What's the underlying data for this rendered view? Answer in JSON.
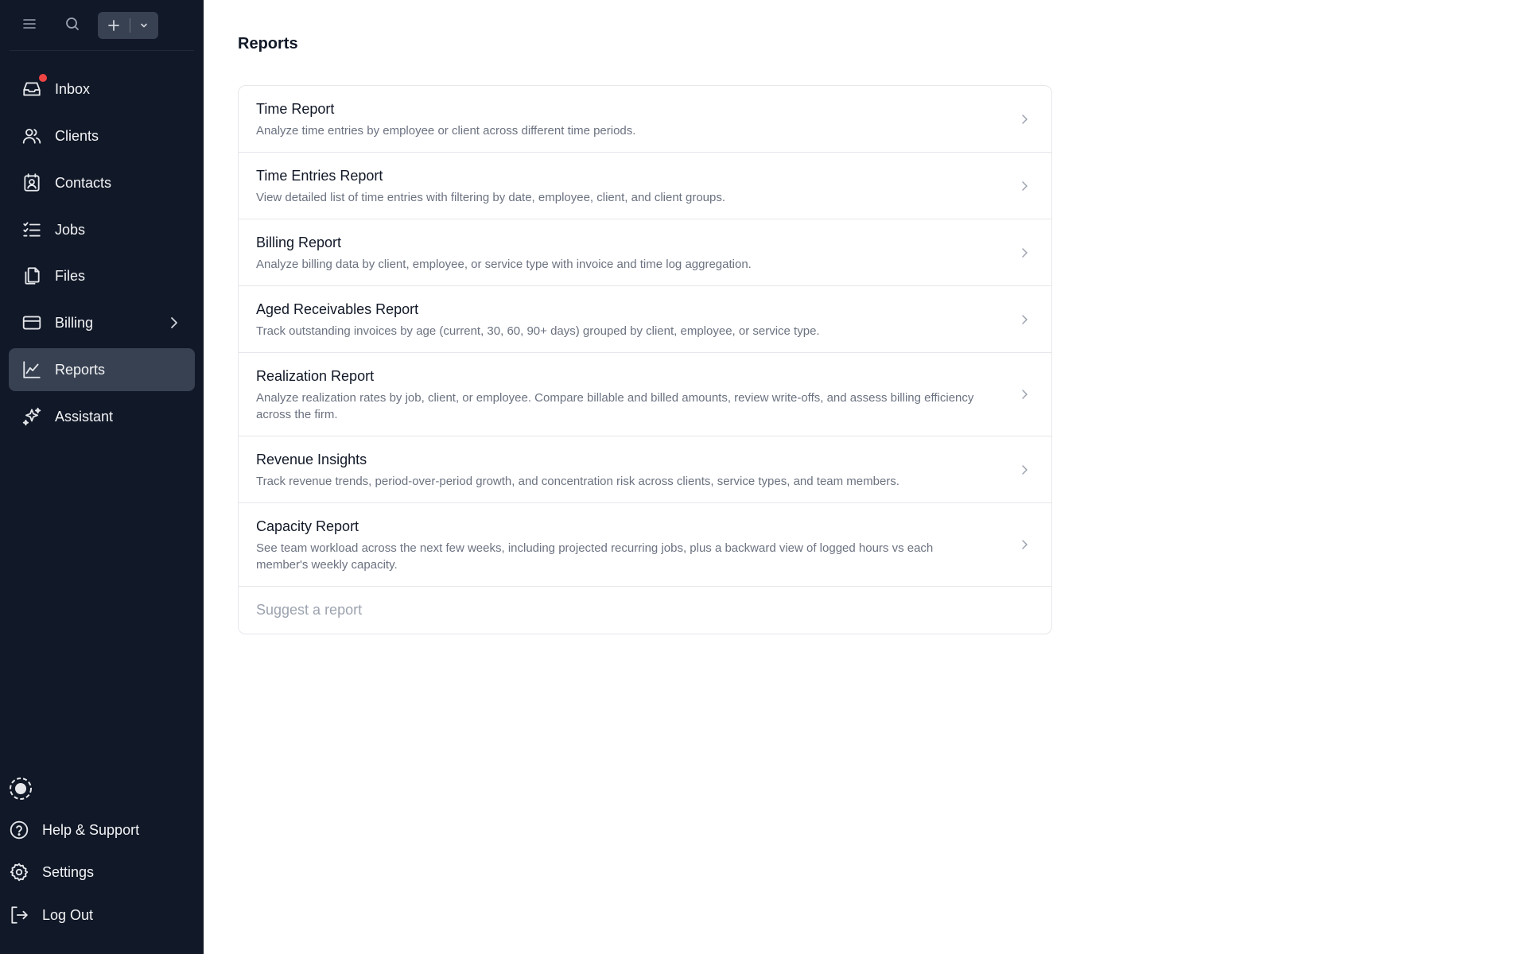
{
  "sidebar": {
    "nav": [
      {
        "label": "Inbox",
        "icon": "inbox-icon",
        "badge": true
      },
      {
        "label": "Clients",
        "icon": "users-icon"
      },
      {
        "label": "Contacts",
        "icon": "contact-card-icon"
      },
      {
        "label": "Jobs",
        "icon": "checklist-icon"
      },
      {
        "label": "Files",
        "icon": "files-icon"
      },
      {
        "label": "Billing",
        "icon": "credit-card-icon",
        "has_submenu": true
      },
      {
        "label": "Reports",
        "icon": "chart-line-icon",
        "active": true
      },
      {
        "label": "Assistant",
        "icon": "sparkles-icon"
      }
    ],
    "bottom": [
      {
        "label": "Help & Support",
        "icon": "help-circle-icon"
      },
      {
        "label": "Settings",
        "icon": "gear-icon"
      },
      {
        "label": "Log Out",
        "icon": "logout-icon"
      }
    ]
  },
  "main": {
    "title": "Reports",
    "reports": [
      {
        "title": "Time Report",
        "description": "Analyze time entries by employee or client across different time periods."
      },
      {
        "title": "Time Entries Report",
        "description": "View detailed list of time entries with filtering by date, employee, client, and client groups."
      },
      {
        "title": "Billing Report",
        "description": "Analyze billing data by client, employee, or service type with invoice and time log aggregation."
      },
      {
        "title": "Aged Receivables Report",
        "description": "Track outstanding invoices by age (current, 30, 60, 90+ days) grouped by client, employee, or service type."
      },
      {
        "title": "Realization Report",
        "description": "Analyze realization rates by job, client, or employee. Compare billable and billed amounts, review write-offs, and assess billing efficiency across the firm."
      },
      {
        "title": "Revenue Insights",
        "description": "Track revenue trends, period-over-period growth, and concentration risk across clients, service types, and team members."
      },
      {
        "title": "Capacity Report",
        "description": "See team workload across the next few weeks, including projected recurring jobs, plus a backward view of logged hours vs each member's weekly capacity."
      }
    ],
    "suggest_label": "Suggest a report"
  },
  "colors": {
    "sidebar_bg": "#111827",
    "active_bg": "#374151",
    "badge": "#ef4444"
  }
}
